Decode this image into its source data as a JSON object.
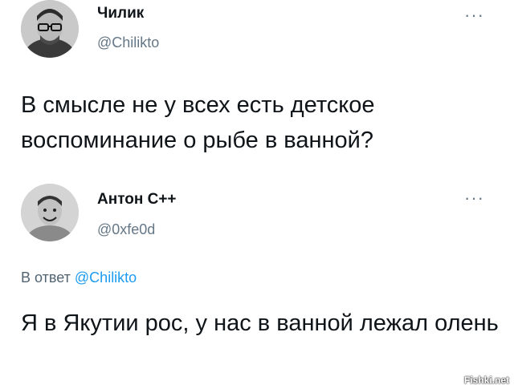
{
  "tweet": {
    "author_name": "Чилик",
    "author_handle": "@Chilikto",
    "text": "В смысле не у всех есть детское воспоминание о рыбе в ванной?",
    "more_icon": "more-horizontal-icon"
  },
  "reply": {
    "author_name": "Антон С++",
    "author_handle": "@0xfe0d",
    "reply_prefix": "В ответ",
    "reply_mention": "@Chilikto",
    "text": "Я в Якутии рос, у нас в ванной лежал олень",
    "more_icon": "more-horizontal-icon"
  },
  "watermark": "Fishki.net",
  "colors": {
    "text": "#0f1419",
    "secondary": "#657786",
    "mention": "#1d9bf0",
    "background": "#ffffff"
  }
}
